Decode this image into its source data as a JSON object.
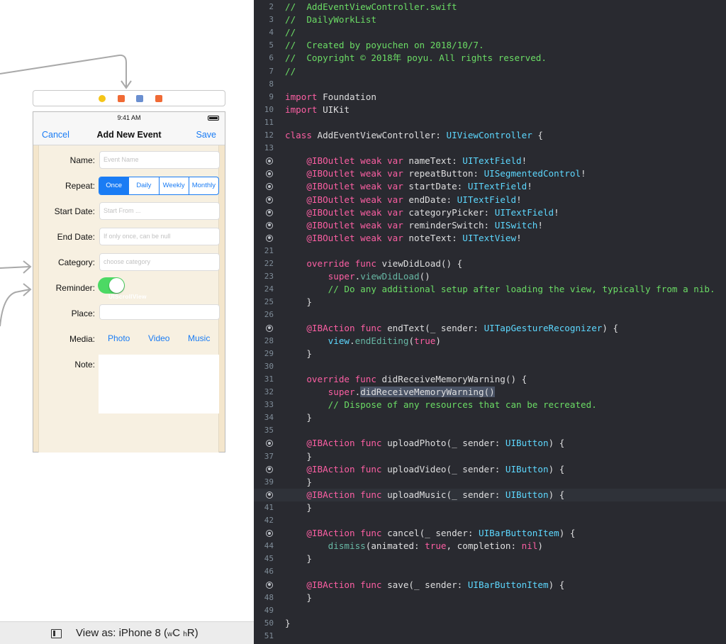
{
  "storyboard": {
    "status_time": "9:41 AM",
    "nav": {
      "cancel": "Cancel",
      "title": "Add New Event",
      "save": "Save"
    },
    "form": {
      "name_label": "Name:",
      "name_placeholder": "Event Name",
      "repeat_label": "Repeat:",
      "repeat_options": [
        "Once",
        "Daily",
        "Weekly",
        "Monthly"
      ],
      "repeat_selected": "Once",
      "start_label": "Start Date:",
      "start_placeholder": "Start From ...",
      "end_label": "End Date:",
      "end_placeholder": "If only once, can be null",
      "category_label": "Category:",
      "category_placeholder": "choose category",
      "reminder_label": "Reminder:",
      "reminder_on": true,
      "scrollview_label": "UIScrollView",
      "place_label": "Place:",
      "media_label": "Media:",
      "media_buttons": [
        "Photo",
        "Video",
        "Music"
      ],
      "note_label": "Note:"
    },
    "footer": {
      "view_as": "View as: iPhone 8 (",
      "w": "w",
      "c": "C",
      "h": "h",
      "r": "R)"
    }
  },
  "colors": {
    "accent": "#1a7cf4",
    "switch_on": "#4cd964",
    "editor_bg": "#292a30",
    "comment": "#6bdc65",
    "keyword": "#fc5fa3",
    "type": "#5dd8ff"
  },
  "editor": {
    "lines": [
      {
        "n": "2",
        "bp": false,
        "hl": false,
        "tokens": [
          [
            "cm",
            "//  AddEventViewController.swift"
          ]
        ]
      },
      {
        "n": "3",
        "bp": false,
        "hl": false,
        "tokens": [
          [
            "cm",
            "//  DailyWorkList"
          ]
        ]
      },
      {
        "n": "4",
        "bp": false,
        "hl": false,
        "tokens": [
          [
            "cm",
            "//"
          ]
        ]
      },
      {
        "n": "5",
        "bp": false,
        "hl": false,
        "tokens": [
          [
            "cm",
            "//  Created by poyuchen on 2018/10/7."
          ]
        ]
      },
      {
        "n": "6",
        "bp": false,
        "hl": false,
        "tokens": [
          [
            "cm",
            "//  Copyright © 2018年 poyu. All rights reserved."
          ]
        ]
      },
      {
        "n": "7",
        "bp": false,
        "hl": false,
        "tokens": [
          [
            "cm",
            "//"
          ]
        ]
      },
      {
        "n": "8",
        "bp": false,
        "hl": false,
        "tokens": []
      },
      {
        "n": "9",
        "bp": false,
        "hl": false,
        "tokens": [
          [
            "kw",
            "import"
          ],
          [
            "tx",
            " Foundation"
          ]
        ]
      },
      {
        "n": "10",
        "bp": false,
        "hl": false,
        "tokens": [
          [
            "kw",
            "import"
          ],
          [
            "tx",
            " UIKit"
          ]
        ]
      },
      {
        "n": "11",
        "bp": false,
        "hl": false,
        "tokens": []
      },
      {
        "n": "12",
        "bp": false,
        "hl": false,
        "tokens": [
          [
            "kw",
            "class"
          ],
          [
            "tx",
            " AddEventViewController: "
          ],
          [
            "ty",
            "UIViewController"
          ],
          [
            "tx",
            " {"
          ]
        ]
      },
      {
        "n": "13",
        "bp": false,
        "hl": false,
        "tokens": []
      },
      {
        "n": "",
        "bp": true,
        "hl": false,
        "tokens": [
          [
            "tx",
            "    "
          ],
          [
            "kw",
            "@IBOutlet weak var"
          ],
          [
            "tx",
            " nameText: "
          ],
          [
            "ty",
            "UITextField"
          ],
          [
            "tx",
            "!"
          ]
        ]
      },
      {
        "n": "",
        "bp": true,
        "hl": false,
        "tokens": [
          [
            "tx",
            "    "
          ],
          [
            "kw",
            "@IBOutlet weak var"
          ],
          [
            "tx",
            " repeatButton: "
          ],
          [
            "ty",
            "UISegmentedControl"
          ],
          [
            "tx",
            "!"
          ]
        ]
      },
      {
        "n": "",
        "bp": true,
        "hl": false,
        "tokens": [
          [
            "tx",
            "    "
          ],
          [
            "kw",
            "@IBOutlet weak var"
          ],
          [
            "tx",
            " startDate: "
          ],
          [
            "ty",
            "UITextField"
          ],
          [
            "tx",
            "!"
          ]
        ]
      },
      {
        "n": "",
        "bp": true,
        "hl": false,
        "tokens": [
          [
            "tx",
            "    "
          ],
          [
            "kw",
            "@IBOutlet weak var"
          ],
          [
            "tx",
            " endDate: "
          ],
          [
            "ty",
            "UITextField"
          ],
          [
            "tx",
            "!"
          ]
        ]
      },
      {
        "n": "",
        "bp": true,
        "hl": false,
        "tokens": [
          [
            "tx",
            "    "
          ],
          [
            "kw",
            "@IBOutlet weak var"
          ],
          [
            "tx",
            " categoryPicker: "
          ],
          [
            "ty",
            "UITextField"
          ],
          [
            "tx",
            "!"
          ]
        ]
      },
      {
        "n": "",
        "bp": true,
        "hl": false,
        "tokens": [
          [
            "tx",
            "    "
          ],
          [
            "kw",
            "@IBOutlet weak var"
          ],
          [
            "tx",
            " reminderSwitch: "
          ],
          [
            "ty",
            "UISwitch"
          ],
          [
            "tx",
            "!"
          ]
        ]
      },
      {
        "n": "",
        "bp": true,
        "hl": false,
        "tokens": [
          [
            "tx",
            "    "
          ],
          [
            "kw",
            "@IBOutlet weak var"
          ],
          [
            "tx",
            " noteText: "
          ],
          [
            "ty",
            "UITextView"
          ],
          [
            "tx",
            "!"
          ]
        ]
      },
      {
        "n": "21",
        "bp": false,
        "hl": false,
        "tokens": []
      },
      {
        "n": "22",
        "bp": false,
        "hl": false,
        "tokens": [
          [
            "tx",
            "    "
          ],
          [
            "kw",
            "override func"
          ],
          [
            "tx",
            " viewDidLoad() {"
          ]
        ]
      },
      {
        "n": "23",
        "bp": false,
        "hl": false,
        "tokens": [
          [
            "tx",
            "        "
          ],
          [
            "kw",
            "super"
          ],
          [
            "tx",
            "."
          ],
          [
            "fn",
            "viewDidLoad"
          ],
          [
            "tx",
            "()"
          ]
        ]
      },
      {
        "n": "24",
        "bp": false,
        "hl": false,
        "tokens": [
          [
            "tx",
            "        "
          ],
          [
            "cm",
            "// Do any additional setup after loading the view, typically from a nib."
          ]
        ]
      },
      {
        "n": "25",
        "bp": false,
        "hl": false,
        "tokens": [
          [
            "tx",
            "    }"
          ]
        ]
      },
      {
        "n": "26",
        "bp": false,
        "hl": false,
        "tokens": []
      },
      {
        "n": "",
        "bp": true,
        "hl": false,
        "tokens": [
          [
            "tx",
            "    "
          ],
          [
            "kw",
            "@IBAction func"
          ],
          [
            "tx",
            " endText(_ sender: "
          ],
          [
            "ty",
            "UITapGestureRecognizer"
          ],
          [
            "tx",
            ") {"
          ]
        ]
      },
      {
        "n": "28",
        "bp": false,
        "hl": false,
        "tokens": [
          [
            "tx",
            "        "
          ],
          [
            "ty",
            "view"
          ],
          [
            "tx",
            "."
          ],
          [
            "fn",
            "endEditing"
          ],
          [
            "tx",
            "("
          ],
          [
            "kw",
            "true"
          ],
          [
            "tx",
            ")"
          ]
        ]
      },
      {
        "n": "29",
        "bp": false,
        "hl": false,
        "tokens": [
          [
            "tx",
            "    }"
          ]
        ]
      },
      {
        "n": "30",
        "bp": false,
        "hl": false,
        "tokens": []
      },
      {
        "n": "31",
        "bp": false,
        "hl": false,
        "tokens": [
          [
            "tx",
            "    "
          ],
          [
            "kw",
            "override func"
          ],
          [
            "tx",
            " didReceiveMemoryWarning() {"
          ]
        ]
      },
      {
        "n": "32",
        "bp": false,
        "hl": false,
        "tokens": [
          [
            "tx",
            "        "
          ],
          [
            "kw",
            "super"
          ],
          [
            "tx",
            "."
          ],
          [
            "sel",
            "didReceiveMemoryWarning()"
          ]
        ]
      },
      {
        "n": "33",
        "bp": false,
        "hl": false,
        "tokens": [
          [
            "tx",
            "        "
          ],
          [
            "cm",
            "// Dispose of any resources that can be recreated."
          ]
        ]
      },
      {
        "n": "34",
        "bp": false,
        "hl": false,
        "tokens": [
          [
            "tx",
            "    }"
          ]
        ]
      },
      {
        "n": "35",
        "bp": false,
        "hl": false,
        "tokens": []
      },
      {
        "n": "",
        "bp": true,
        "hl": false,
        "tokens": [
          [
            "tx",
            "    "
          ],
          [
            "kw",
            "@IBAction func"
          ],
          [
            "tx",
            " uploadPhoto(_ sender: "
          ],
          [
            "ty",
            "UIButton"
          ],
          [
            "tx",
            ") {"
          ]
        ]
      },
      {
        "n": "37",
        "bp": false,
        "hl": false,
        "tokens": [
          [
            "tx",
            "    }"
          ]
        ]
      },
      {
        "n": "",
        "bp": true,
        "hl": false,
        "tokens": [
          [
            "tx",
            "    "
          ],
          [
            "kw",
            "@IBAction func"
          ],
          [
            "tx",
            " uploadVideo(_ sender: "
          ],
          [
            "ty",
            "UIButton"
          ],
          [
            "tx",
            ") {"
          ]
        ]
      },
      {
        "n": "39",
        "bp": false,
        "hl": false,
        "tokens": [
          [
            "tx",
            "    }"
          ]
        ]
      },
      {
        "n": "",
        "bp": true,
        "hl": true,
        "tokens": [
          [
            "tx",
            "    "
          ],
          [
            "kw",
            "@IBAction func"
          ],
          [
            "tx",
            " uploadMusic(_ sender: "
          ],
          [
            "ty",
            "UIButton"
          ],
          [
            "tx",
            ") {"
          ]
        ]
      },
      {
        "n": "41",
        "bp": false,
        "hl": false,
        "tokens": [
          [
            "tx",
            "    }"
          ]
        ]
      },
      {
        "n": "42",
        "bp": false,
        "hl": false,
        "tokens": []
      },
      {
        "n": "",
        "bp": true,
        "hl": false,
        "tokens": [
          [
            "tx",
            "    "
          ],
          [
            "kw",
            "@IBAction func"
          ],
          [
            "tx",
            " cancel(_ sender: "
          ],
          [
            "ty",
            "UIBarButtonItem"
          ],
          [
            "tx",
            ") {"
          ]
        ]
      },
      {
        "n": "44",
        "bp": false,
        "hl": false,
        "tokens": [
          [
            "tx",
            "        "
          ],
          [
            "fn",
            "dismiss"
          ],
          [
            "tx",
            "(animated: "
          ],
          [
            "kw",
            "true"
          ],
          [
            "tx",
            ", completion: "
          ],
          [
            "kw",
            "nil"
          ],
          [
            "tx",
            ")"
          ]
        ]
      },
      {
        "n": "45",
        "bp": false,
        "hl": false,
        "tokens": [
          [
            "tx",
            "    }"
          ]
        ]
      },
      {
        "n": "46",
        "bp": false,
        "hl": false,
        "tokens": []
      },
      {
        "n": "",
        "bp": true,
        "hl": false,
        "tokens": [
          [
            "tx",
            "    "
          ],
          [
            "kw",
            "@IBAction func"
          ],
          [
            "tx",
            " save(_ sender: "
          ],
          [
            "ty",
            "UIBarButtonItem"
          ],
          [
            "tx",
            ") {"
          ]
        ]
      },
      {
        "n": "48",
        "bp": false,
        "hl": false,
        "tokens": [
          [
            "tx",
            "    }"
          ]
        ]
      },
      {
        "n": "49",
        "bp": false,
        "hl": false,
        "tokens": []
      },
      {
        "n": "50",
        "bp": false,
        "hl": false,
        "tokens": [
          [
            "tx",
            "}"
          ]
        ]
      },
      {
        "n": "51",
        "bp": false,
        "hl": false,
        "tokens": []
      }
    ]
  }
}
